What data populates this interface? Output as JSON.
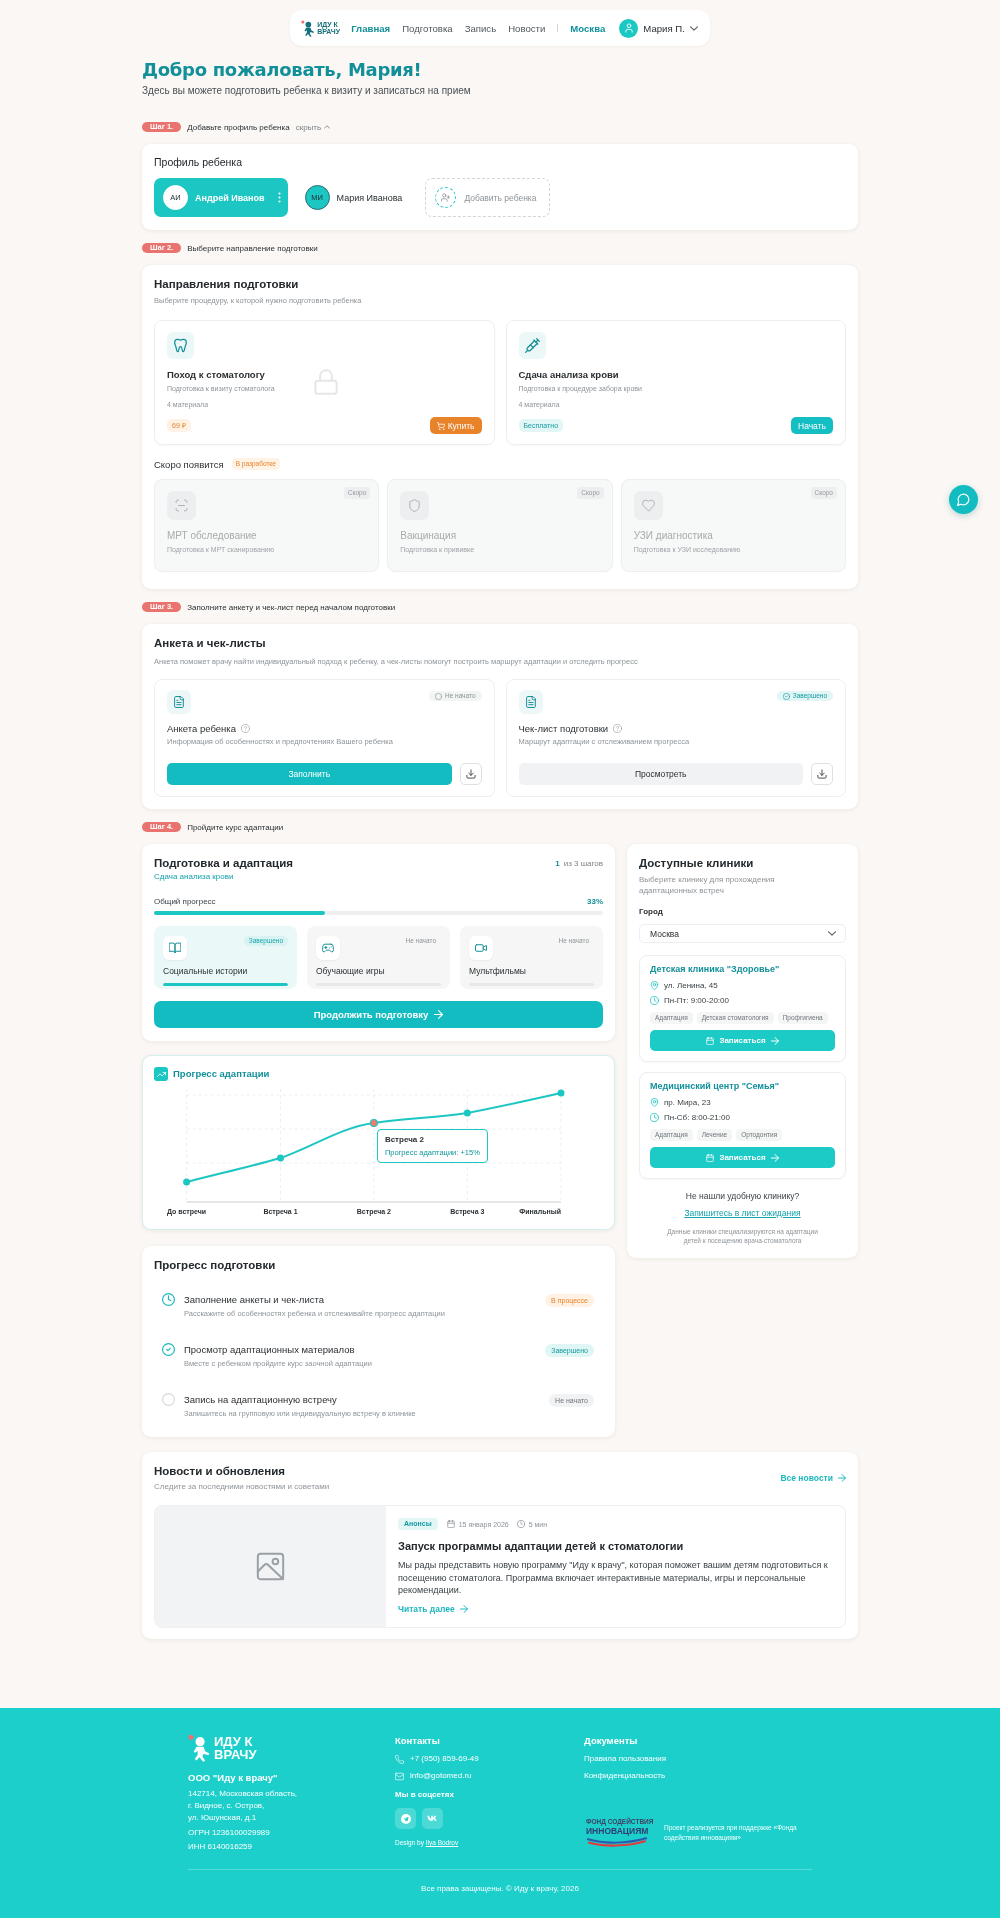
{
  "header": {
    "logo": "ИДУ К ВРАЧУ",
    "nav": [
      {
        "label": "Главная",
        "selected": true
      },
      {
        "label": "Подготовка",
        "selected": false
      },
      {
        "label": "Запись",
        "selected": false
      },
      {
        "label": "Новости",
        "selected": false
      }
    ],
    "city": "Москва",
    "user": "Мария П."
  },
  "welcome": {
    "title": "Добро пожаловать, Мария!",
    "subtitle": "Здесь вы можете подготовить ребенка к визиту и записаться на прием"
  },
  "profile": {
    "step": {
      "badge": "Шаг 1.",
      "text": "Добавьте профиль ребенка",
      "toggle": "скрыть"
    },
    "title": "Профиль ребенка",
    "children": [
      {
        "initials": "АИ",
        "name": "Андрей Иванов",
        "selected": true
      },
      {
        "initials": "МИ",
        "name": "Мария Иванова",
        "selected": false
      }
    ],
    "add_label": "Добавить ребенка"
  },
  "directions": {
    "step": {
      "badge": "Шаг 2.",
      "text": "Выберите направление подготовки"
    },
    "title": "Направления подготовки",
    "subtitle": "Выберите процедуру, к которой нужно подготовить ребенка",
    "items": [
      {
        "kind": "paid",
        "title": "Поход к стоматологу",
        "subtitle": "Подготовка к визиту стоматолога",
        "materials": "4 материала",
        "price": "69 ₽",
        "button": "Купить",
        "locked": true
      },
      {
        "kind": "free",
        "title": "Сдача анализа крови",
        "subtitle": "Подготовка к процедуре забора крови",
        "materials": "4 материала",
        "price": "Бесплатно",
        "button": "Начать",
        "locked": false
      }
    ],
    "soon_title": "Скоро появится",
    "soon_tag": "В разработке",
    "soon": [
      {
        "title": "МРТ обследование",
        "subtitle": "Подготовка к МРТ сканированию",
        "tag": "Скоро",
        "disabled": true
      },
      {
        "title": "Вакцинация",
        "subtitle": "Подготовка к прививке",
        "tag": "Скоро",
        "disabled": true
      },
      {
        "title": "УЗИ диагностика",
        "subtitle": "Подготовка к УЗИ исследованию",
        "tag": "Скоро",
        "disabled": true
      }
    ]
  },
  "forms": {
    "step": {
      "badge": "Шаг 3.",
      "text": "Заполните анкету и чек-лист перед началом подготовки"
    },
    "title": "Анкета и чек-листы",
    "subtitle": "Анкета поможет врачу найти индивидуальный подход к ребенку, а чек-листы помогут построить маршрут адаптации и отследить прогресс",
    "items": [
      {
        "kind": "not_started",
        "status": "Не начато",
        "title": "Анкета ребенка",
        "description": "Информация об особенностях и предпочтениях Вашего ребенка",
        "button": "Заполнить"
      },
      {
        "kind": "done",
        "status": "Завершено",
        "title": "Чек-лист подготовки",
        "description": "Маршрут адаптации с отслеживанием прогресса",
        "button": "Просмотреть"
      }
    ]
  },
  "preparation": {
    "step": {
      "badge": "Шаг 4.",
      "text": "Пройдите курс адаптации"
    },
    "title": "Подготовка и адаптация",
    "direction": "Сдача анализа крови",
    "current_step": "1",
    "steps_total": "из 3 шагов",
    "progress_label": "Общий прогресс",
    "progress_value": "33%",
    "level": 0.38,
    "modules": [
      {
        "kind": "done",
        "title": "Социальные истории",
        "status": "Завершено",
        "level": 1
      },
      {
        "kind": "not_started",
        "title": "Обучающие игры",
        "status": "Не начато",
        "level": 0
      },
      {
        "kind": "not_started",
        "title": "Мультфильмы",
        "status": "Не начато",
        "level": 0
      }
    ],
    "button": "Продолжить подготовку"
  },
  "adaptation_chart": {
    "title": "Прогресс адаптации",
    "categories": [
      {
        "label": "До встречи",
        "selected": false
      },
      {
        "label": "Встреча 1",
        "selected": false
      },
      {
        "label": "Встреча 2",
        "selected": true
      },
      {
        "label": "Встреча 3",
        "selected": false
      },
      {
        "label": "Финальный",
        "selected": false
      }
    ],
    "tooltip": {
      "title": "Встреча 2",
      "text": "Прогресс адаптации: +15%"
    }
  },
  "progress": {
    "title": "Прогресс подготовки",
    "items": [
      {
        "kind": "in_progress",
        "title": "Заполнение анкеты и чек-листа",
        "description": "Расскажите об особенностях ребенка и отслеживайте прогресс адаптации",
        "status": "В процессе"
      },
      {
        "kind": "done",
        "title": "Просмотр адаптационных материалов",
        "description": "Вместе с ребенком пройдите курс заочной адаптации",
        "status": "Завершено"
      },
      {
        "kind": "not_started",
        "title": "Запись на адаптационную встречу",
        "description": "Запишитесь на групповую или индивидуальную встречу в клинике",
        "status": "Не начато"
      }
    ]
  },
  "clinics": {
    "title": "Доступные клиники",
    "subtitle": "Выберите клинику для прохождения адаптационных встреч",
    "city_label": "Город",
    "city_value": "Москва",
    "items": [
      {
        "name": "Детская клиника \"Здоровье\"",
        "address": "ул. Ленина, 45",
        "hours": "Пн-Пт: 9:00-20:00",
        "tags": [
          "Адаптация",
          "Детская стоматология",
          "Профгигиена"
        ],
        "button": "Записаться"
      },
      {
        "name": "Медицинский центр \"Семья\"",
        "address": "пр. Мира, 23",
        "hours": "Пн-Сб: 8:00-21:00",
        "tags": [
          "Адаптация",
          "Лечение",
          "Ортодонтия"
        ],
        "button": "Записаться"
      }
    ],
    "not_found": "Не нашли удобную клинику?",
    "waitlist": "Запишитесь в лист ожидания",
    "note": "Данные клиники специализируются на адаптации детей к посещению врача-стоматолога"
  },
  "news": {
    "title": "Новости и обновления",
    "subtitle": "Следите за последними новостями и советами",
    "all_link": "Все новости",
    "article": {
      "tag": "Анонсы",
      "date": "15 января 2026",
      "read_time": "5 мин",
      "title": "Запуск программы адаптации детей к стоматологии",
      "text": "Мы рады представить новую программу \"Иду к врачу\", которая поможет вашим детям подготовиться к посещению стоматолога. Программа включает интерактивные материалы, игры и персональные рекомендации.",
      "more": "Читать далее"
    }
  },
  "footer": {
    "logo": "ИДУ К ВРАЧУ",
    "company": "ООО \"Иду к врачу\"",
    "address": [
      "142714, Московская область,",
      "г. Видное, с. Остров,",
      "ул. Юшунская, д.1"
    ],
    "ogrn": "ОГРН 1236100029989",
    "inn": "ИНН 6140016259",
    "contacts_title": "Контакты",
    "phone": "+7 (950) 859-69-49",
    "email": "info@gotomed.ru",
    "social_title": "Мы в соцсетях",
    "design_prefix": "Design by",
    "designer": "Ilya Bodrov",
    "documents_title": "Документы",
    "documents": [
      "Правила пользования",
      "Конфиденциальность"
    ],
    "fund_logo": [
      "ФОНД СОДЕЙСТВИЯ",
      "ИННОВАЦИЯМ"
    ],
    "fund_note": "Проект реализуется при поддержке «Фонда содействия инновациям»",
    "copyright": "Все права защищены. © Иду к врачу, 2026"
  }
}
